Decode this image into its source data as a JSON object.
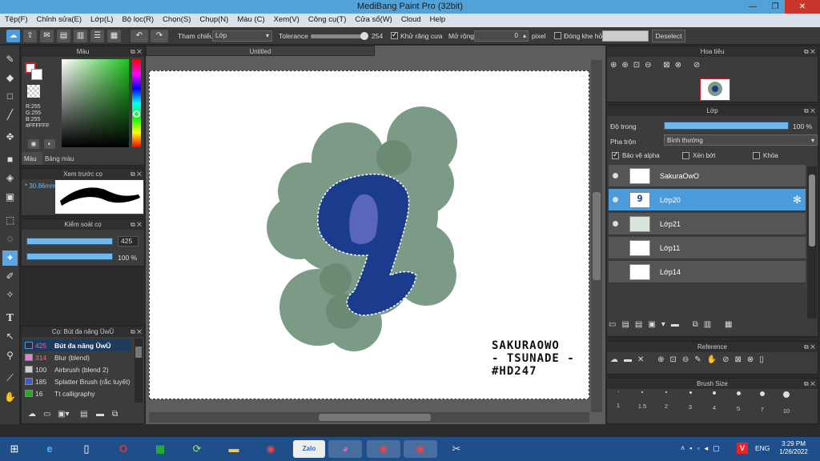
{
  "window": {
    "title": "MediBang Paint Pro (32bit)",
    "minimize": "—",
    "restore": "❐",
    "close": "✕"
  },
  "menu": [
    "Tệp(F)",
    "Chỉnh sửa(E)",
    "Lớp(L)",
    "Bộ lọc(R)",
    "Chọn(S)",
    "Chụp(N)",
    "Màu (C)",
    "Xem(V)",
    "Công cụ(T)",
    "Cửa sổ(W)",
    "Cloud",
    "Help"
  ],
  "toolbar": {
    "reference_label": "Tham chiếu",
    "reference_value": "Lớp",
    "tolerance_label": "Tolerance",
    "tolerance_value": "254",
    "antialias_label": "Khử răng cưa",
    "expand_label": "Mở rộng",
    "expand_value": "0",
    "expand_unit": "pixel",
    "close_gap_label": "Đóng khe hở",
    "deselect_label": "Deselect"
  },
  "color_panel": {
    "title": "Màu",
    "readout": [
      "R:255",
      "G:255",
      "B:255",
      "#FFFFFF"
    ],
    "tab_color": "Màu",
    "tab_palette": "Bảng màu"
  },
  "brush_preview": {
    "title": "Xem trước cọ",
    "size": "30.86mm"
  },
  "brush_control": {
    "title": "Kiểm soát cọ",
    "size_value": "425",
    "opacity_value": "100 %"
  },
  "brush_list": {
    "title": "Cọ: Bút đa năng ŬwŬ",
    "items": [
      {
        "size": "425",
        "name": "Bút đa năng ŬwŬ",
        "color": "#1e2d4a"
      },
      {
        "size": "314",
        "name": "Blur (blend)",
        "color": "#e87ad8"
      },
      {
        "size": "100",
        "name": "Airbrush (blend 2)",
        "color": "#cfcfcf"
      },
      {
        "size": "185",
        "name": "Splatter Brush (rắc tuyết)",
        "color": "#3a5ad8"
      },
      {
        "size": "16",
        "name": "Tt calligraphy",
        "color": "#22aa22"
      }
    ]
  },
  "document": {
    "tab": "Untitled"
  },
  "artwork": {
    "signature": [
      "SAKURAOWO",
      "- TSUNADE -",
      "#HD247"
    ]
  },
  "navigator": {
    "title": "Hoa tiêu"
  },
  "layers": {
    "title": "Lớp",
    "opacity_label": "Độ trong",
    "opacity_value": "100 %",
    "blend_label": "Pha trộn",
    "blend_value": "Bình thường",
    "protect_alpha": "Bảo vệ alpha",
    "clipping": "Xén bớt",
    "lock": "Khóa",
    "items": [
      {
        "name": "SakuraOwO"
      },
      {
        "name": "Lớp20"
      },
      {
        "name": "Lớp21"
      },
      {
        "name": "Lớp11"
      },
      {
        "name": "Lớp14"
      }
    ]
  },
  "reference_panel": {
    "title": "Reference"
  },
  "brush_size_panel": {
    "title": "Brush Size",
    "sizes": [
      "1",
      "1.5",
      "2",
      "3",
      "4",
      "5",
      "7",
      "10"
    ]
  },
  "taskbar": {
    "lang": "ENG",
    "time": "3:29 PM",
    "date": "1/26/2022",
    "apps": [
      "windows-start",
      "internet-explorer",
      "file",
      "opera",
      "store",
      "green-app",
      "file-explorer",
      "chrome",
      "zalo",
      "medibang",
      "chrome-profile",
      "chrome-2",
      "paint-app"
    ]
  },
  "colors": {
    "accent": "#4c9bdc",
    "primary_color": "#ffffff",
    "secondary_color": "#c62026"
  }
}
